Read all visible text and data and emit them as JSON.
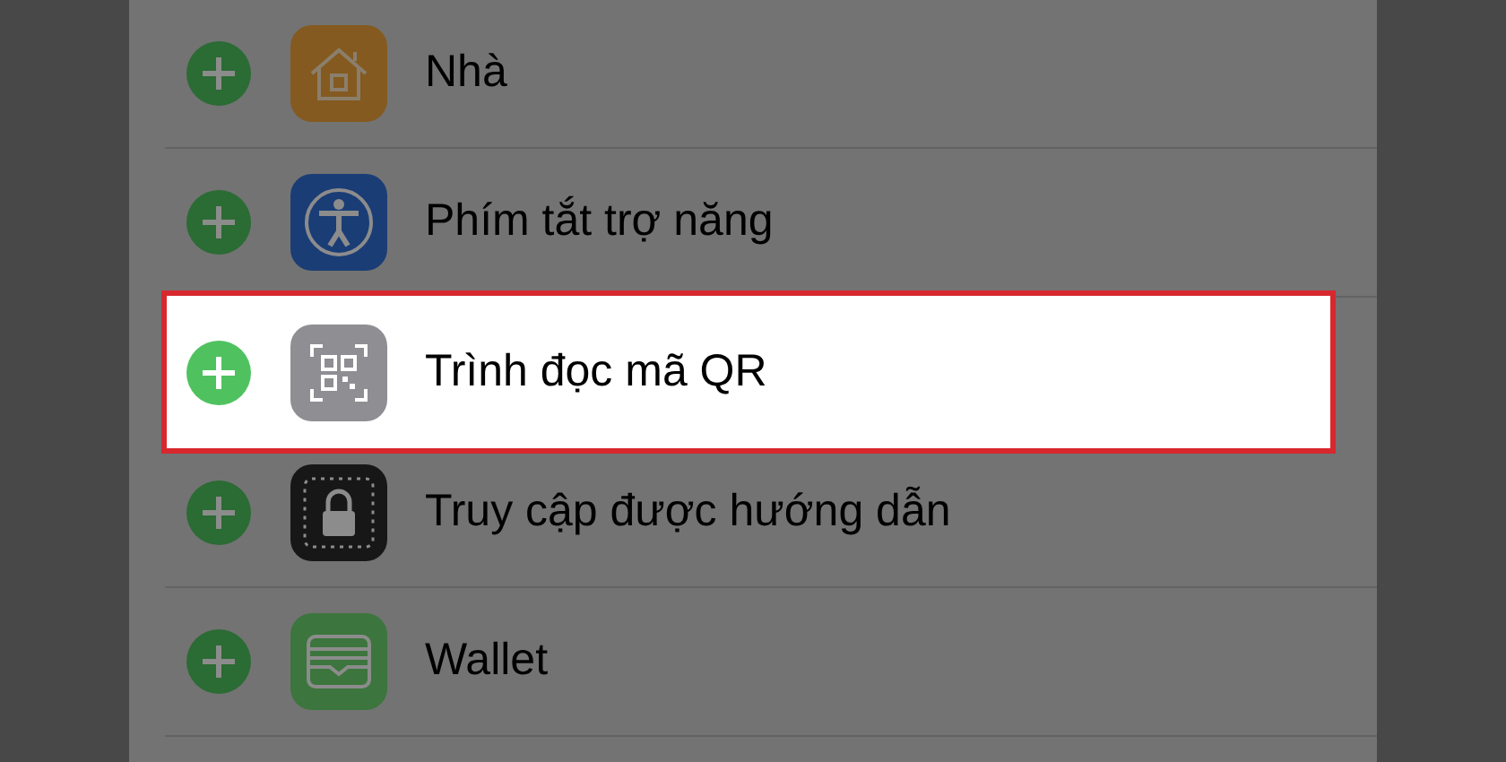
{
  "rows": [
    {
      "label": "Nhà",
      "kind": "home",
      "highlighted": false
    },
    {
      "label": "Phím tắt trợ năng",
      "kind": "accessibility",
      "highlighted": false
    },
    {
      "label": "Trình đọc mã QR",
      "kind": "qr",
      "highlighted": true
    },
    {
      "label": "Truy cập được hướng dẫn",
      "kind": "lock",
      "highlighted": false
    },
    {
      "label": "Wallet",
      "kind": "wallet",
      "highlighted": false
    }
  ]
}
